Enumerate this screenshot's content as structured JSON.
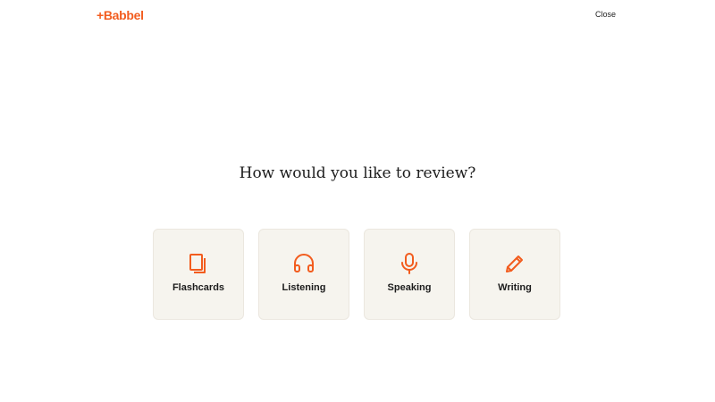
{
  "header": {
    "logo_text": "+Babbel",
    "close_label": "Close"
  },
  "main": {
    "title": "How would you like to review?",
    "options": [
      {
        "label": "Flashcards",
        "icon": "flashcards-icon"
      },
      {
        "label": "Listening",
        "icon": "headphones-icon"
      },
      {
        "label": "Speaking",
        "icon": "microphone-icon"
      },
      {
        "label": "Writing",
        "icon": "pencil-icon"
      }
    ]
  },
  "colors": {
    "accent": "#f25c1e",
    "card_background": "#f6f4ee",
    "text": "#1c1c1c"
  }
}
